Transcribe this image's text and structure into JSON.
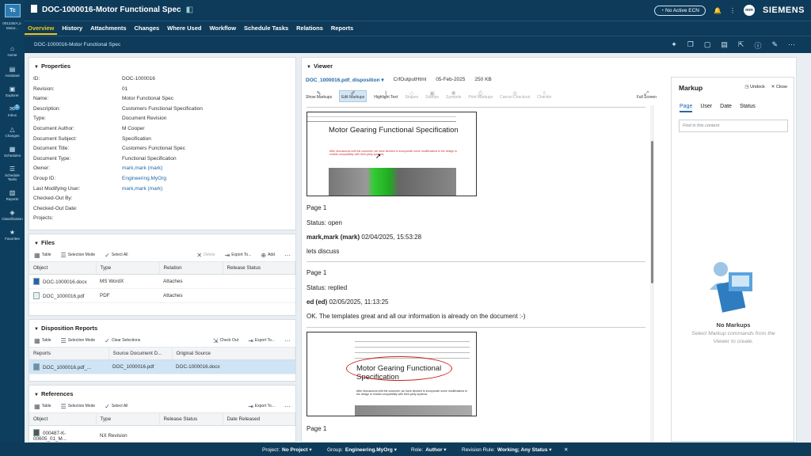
{
  "rail": {
    "logo": "Tc",
    "context": "001230/A;1-Motor...",
    "items": [
      "Home",
      "Assistant",
      "Explorer",
      "Inbox",
      "Changes",
      "Schedules",
      "Schedule Tasks",
      "Reports",
      "Classification",
      "Favorites"
    ],
    "inbox_count": "1"
  },
  "header": {
    "title": "DOC-1000016-Motor Functional Spec",
    "ecn": "No Active ECN",
    "avatar": "mm",
    "brand": "SIEMENS"
  },
  "tabs": [
    "Overview",
    "History",
    "Attachments",
    "Changes",
    "Where Used",
    "Workflow",
    "Schedule Tasks",
    "Relations",
    "Reports"
  ],
  "breadcrumb": "DOC-1000016-Motor Functional Spec",
  "properties": {
    "heading": "Properties",
    "rows": [
      {
        "label": "ID:",
        "value": "DOC-1000016"
      },
      {
        "label": "Revision:",
        "value": "01"
      },
      {
        "label": "Name:",
        "value": "Motor Functional Spec"
      },
      {
        "label": "Description:",
        "value": "Customers Functional Specification"
      },
      {
        "label": "Type:",
        "value": "Document Revision"
      },
      {
        "label": "Document Author:",
        "value": "M Cooper"
      },
      {
        "label": "Document Subject:",
        "value": "Specification"
      },
      {
        "label": "Document Title:",
        "value": "Customers Functional Spec"
      },
      {
        "label": "Document Type:",
        "value": "Functional Specification"
      },
      {
        "label": "Owner:",
        "value": "mark,mark (mark)"
      },
      {
        "label": "Group ID:",
        "value": "Engineering.MyOrg"
      },
      {
        "label": "Last Modifying User:",
        "value": "mark,mark (mark)"
      },
      {
        "label": "Checked-Out By:",
        "value": ""
      },
      {
        "label": "Checked-Out Date:",
        "value": ""
      },
      {
        "label": "Projects:",
        "value": ""
      }
    ]
  },
  "files": {
    "heading": "Files",
    "tools": [
      "Table",
      "Selection Mode",
      "Select All",
      "Delete",
      "Export To...",
      "Add"
    ],
    "columns": [
      "Object",
      "Type",
      "Relation",
      "Release Status"
    ],
    "rows": [
      {
        "object": "DOC-1000016.docx",
        "type": "MS WordX",
        "relation": "Attaches",
        "status": ""
      },
      {
        "object": "DOC_1000016.pdf",
        "type": "PDF",
        "relation": "Attaches",
        "status": ""
      }
    ]
  },
  "disposition": {
    "heading": "Disposition Reports",
    "tools": [
      "Table",
      "Selection Mode",
      "Clear Selections",
      "Check Out",
      "Export To..."
    ],
    "columns": [
      "Reports",
      "Source Document D...",
      "Original Source"
    ],
    "rows": [
      {
        "report": "DOC_1000016.pdf_...",
        "source": "DOC_1000016.pdf",
        "original": "DOC-1000016.docx"
      }
    ]
  },
  "references": {
    "heading": "References",
    "tools": [
      "Table",
      "Selection Mode",
      "Select All",
      "Export To..."
    ],
    "columns": [
      "Object",
      "Type",
      "Release Status",
      "Date Released"
    ],
    "rows": [
      {
        "object": "000487-K-00605_01_M...",
        "type": "NX Revision",
        "status": "",
        "date": ""
      }
    ]
  },
  "viewer": {
    "heading": "Viewer",
    "file": "DOC_1000016.pdf_disposition",
    "format": "CrfOutputHtml",
    "date": "05-Feb-2025",
    "size": "250 KB",
    "tools": [
      "Show Markups",
      "Edit Markups",
      "Highlight Text",
      "Shapes",
      "Stamps",
      "Symbols",
      "Print Markups",
      "Cancel Checkout",
      "Checkin",
      "Full Screen"
    ],
    "page1": {
      "doc_title": "Motor Gearing Functional Specification",
      "doc_note": "After discussions with the customer, we have decided to incorporate some modifications to the design to enable compatibility with third party systems.",
      "page": "Page 1",
      "status": "Status: open",
      "author": "mark,mark (mark)",
      "timestamp": "02/04/2025, 15:53:28",
      "comment": "lets discuss"
    },
    "page2": {
      "page": "Page 1",
      "status": "Status: replied",
      "author": "ed (ed)",
      "timestamp": "02/05/2025, 11:13:25",
      "comment": "OK. The templates great and all our information is already on the document :-)"
    },
    "page3": {
      "doc_title": "Motor Gearing Functional Specification",
      "doc_note": "After discussions with the customer, we have decided to incorporate some modifications to the design to enable compatibility with third party systems.",
      "page": "Page 1"
    }
  },
  "markup": {
    "title": "Markup",
    "undock": "Undock",
    "close": "Close",
    "tabs": [
      "Page",
      "User",
      "Date",
      "Status"
    ],
    "search_placeholder": "Find in this content",
    "empty_title": "No Markups",
    "empty_text": "Select Markup commands from the Viewer to create."
  },
  "statusbar": {
    "project_label": "Project:",
    "project": "No Project",
    "group_label": "Group:",
    "group": "Engineering.MyOrg",
    "role_label": "Role:",
    "role": "Author",
    "rule_label": "Revision Rule:",
    "rule": "Working; Any Status"
  }
}
